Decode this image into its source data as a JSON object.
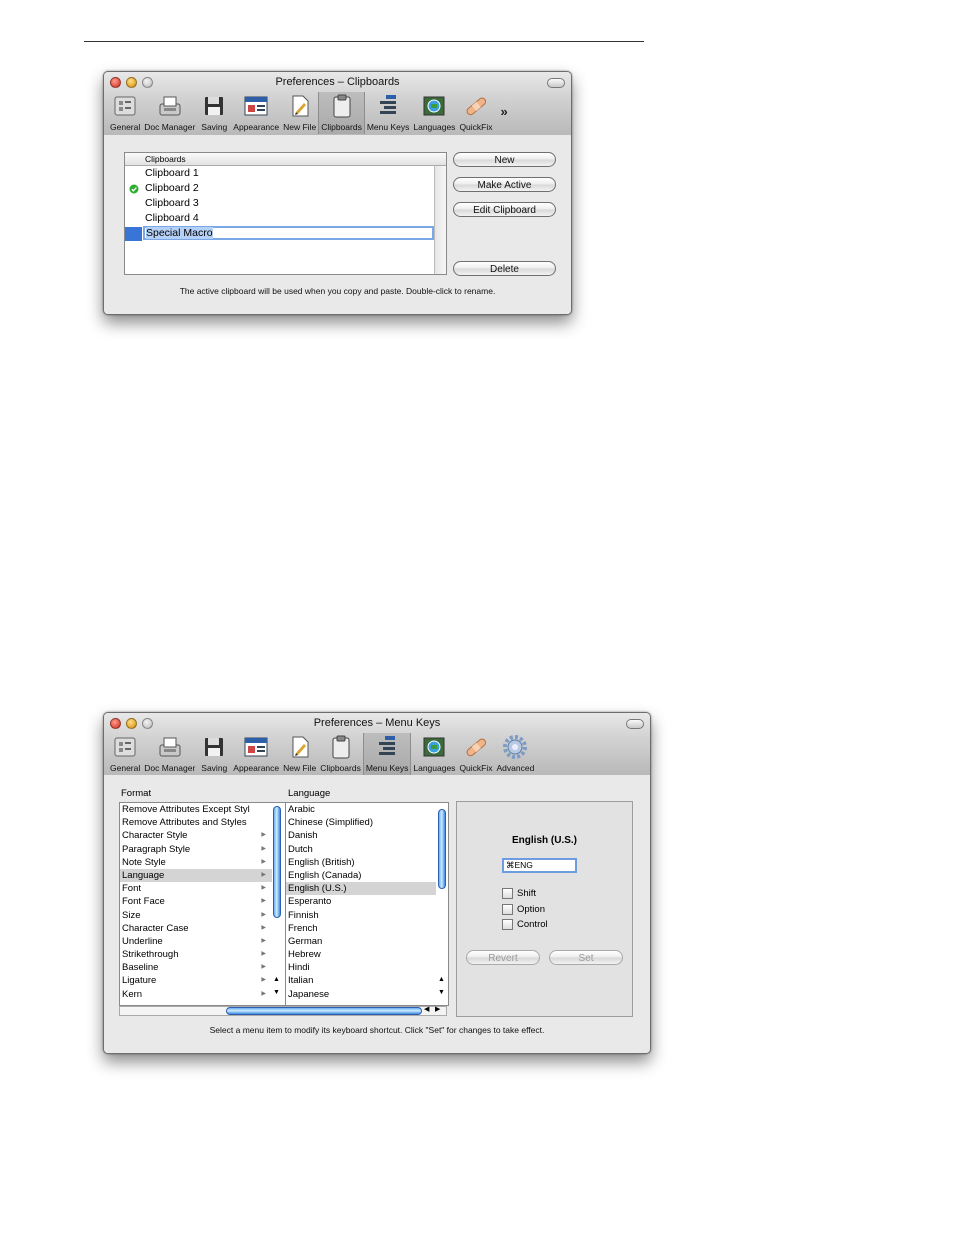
{
  "clipboards_window": {
    "title": "Preferences – Clipboards",
    "toolbar": [
      "General",
      "Doc Manager",
      "Saving",
      "Appearance",
      "New File",
      "Clipboards",
      "Menu Keys",
      "Languages",
      "QuickFix"
    ],
    "more_label": "»",
    "list_header": "Clipboards",
    "items": [
      "Clipboard 1",
      "Clipboard 2",
      "Clipboard 3",
      "Clipboard 4",
      "Special Macro"
    ],
    "active_item": "Clipboard 2",
    "editing_item": "Special Macro",
    "buttons": {
      "new": "New",
      "make_active": "Make Active",
      "edit": "Edit Clipboard",
      "delete": "Delete"
    },
    "hint": "The active clipboard will be used when you copy and paste.  Double-click to rename."
  },
  "menukeys_window": {
    "title": "Preferences – Menu Keys",
    "toolbar": [
      "General",
      "Doc Manager",
      "Saving",
      "Appearance",
      "New File",
      "Clipboards",
      "Menu Keys",
      "Languages",
      "QuickFix",
      "Advanced"
    ],
    "format_label": "Format",
    "language_label": "Language",
    "format_items": [
      "Remove Attributes Except Styl",
      "Remove Attributes and Styles",
      "Character Style",
      "Paragraph Style",
      "Note Style",
      "Language",
      "Font",
      "Font Face",
      "Size",
      "Character Case",
      "Underline",
      "Strikethrough",
      "Baseline",
      "Ligature",
      "Kern"
    ],
    "format_selected": "Language",
    "language_items": [
      "Arabic",
      "Chinese (Simplified)",
      "Danish",
      "Dutch",
      "English (British)",
      "English (Canada)",
      "English (U.S.)",
      "Esperanto",
      "Finnish",
      "French",
      "German",
      "Hebrew",
      "Hindi",
      "Italian",
      "Japanese"
    ],
    "language_selected": "English (U.S.)",
    "selected_name": "English (U.S.)",
    "shortcut_value": "⌘ENG",
    "modifiers": [
      "Shift",
      "Option",
      "Control"
    ],
    "revert_label": "Revert",
    "set_label": "Set",
    "hint": "Select a menu item to modify its keyboard shortcut.  Click \"Set\" for changes to take effect."
  },
  "colors": {
    "accent": "#3875d7",
    "active_dot": "#2fae2f"
  }
}
